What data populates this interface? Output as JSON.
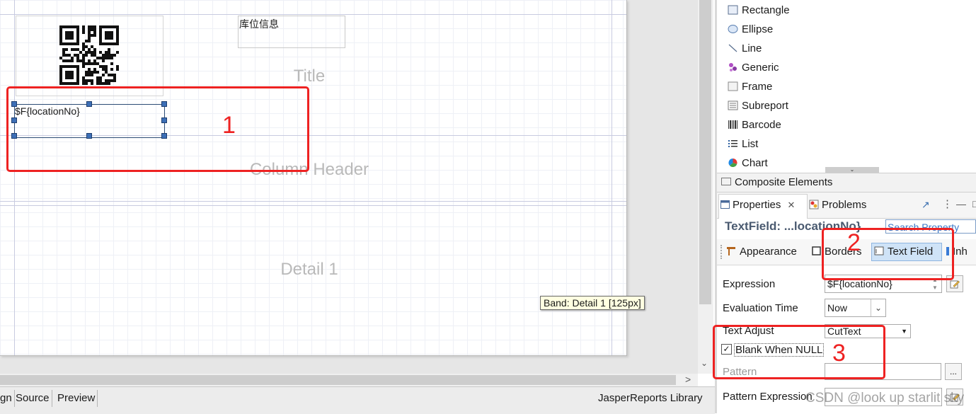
{
  "designer": {
    "bands": {
      "title": "Title",
      "column_header": "Column Header",
      "detail": "Detail 1"
    },
    "elements": {
      "location_info_label": "库位信息",
      "text_field_expression": "$F{locationNo}"
    },
    "tooltip": "Band: Detail 1 [125px]"
  },
  "annotations": [
    "1",
    "2",
    "3"
  ],
  "editor_tabs": {
    "design_partial": "gn",
    "source": "Source",
    "preview": "Preview"
  },
  "library_label": "JasperReports Library",
  "palette": {
    "items": [
      {
        "label": "Rectangle",
        "icon": "rectangle-icon"
      },
      {
        "label": "Ellipse",
        "icon": "ellipse-icon"
      },
      {
        "label": "Line",
        "icon": "line-icon"
      },
      {
        "label": "Generic",
        "icon": "generic-icon"
      },
      {
        "label": "Frame",
        "icon": "frame-icon"
      },
      {
        "label": "Subreport",
        "icon": "subreport-icon"
      },
      {
        "label": "Barcode",
        "icon": "barcode-icon"
      },
      {
        "label": "List",
        "icon": "list-icon"
      },
      {
        "label": "Chart",
        "icon": "chart-icon"
      }
    ],
    "composite_elements": "Composite Elements"
  },
  "properties": {
    "tab_properties": "Properties",
    "tab_problems": "Problems",
    "title": "TextField: ...locationNo}",
    "search_placeholder": "Search Property",
    "sections": {
      "appearance": "Appearance",
      "borders": "Borders",
      "text_field": "Text Field",
      "inheritance_partial": "Inh"
    },
    "fields": {
      "expression_label": "Expression",
      "expression_value": "$F{locationNo}",
      "evaluation_time_label": "Evaluation Time",
      "evaluation_time_value": "Now",
      "text_adjust_label": "Text Adjust",
      "text_adjust_value": "CutText",
      "blank_when_null_label": "Blank When NULL",
      "blank_when_null_checked": true,
      "pattern_label": "Pattern",
      "pattern_value": "",
      "pattern_expression_label": "Pattern Expression"
    }
  },
  "watermark": "CSDN @look up starlit sky"
}
